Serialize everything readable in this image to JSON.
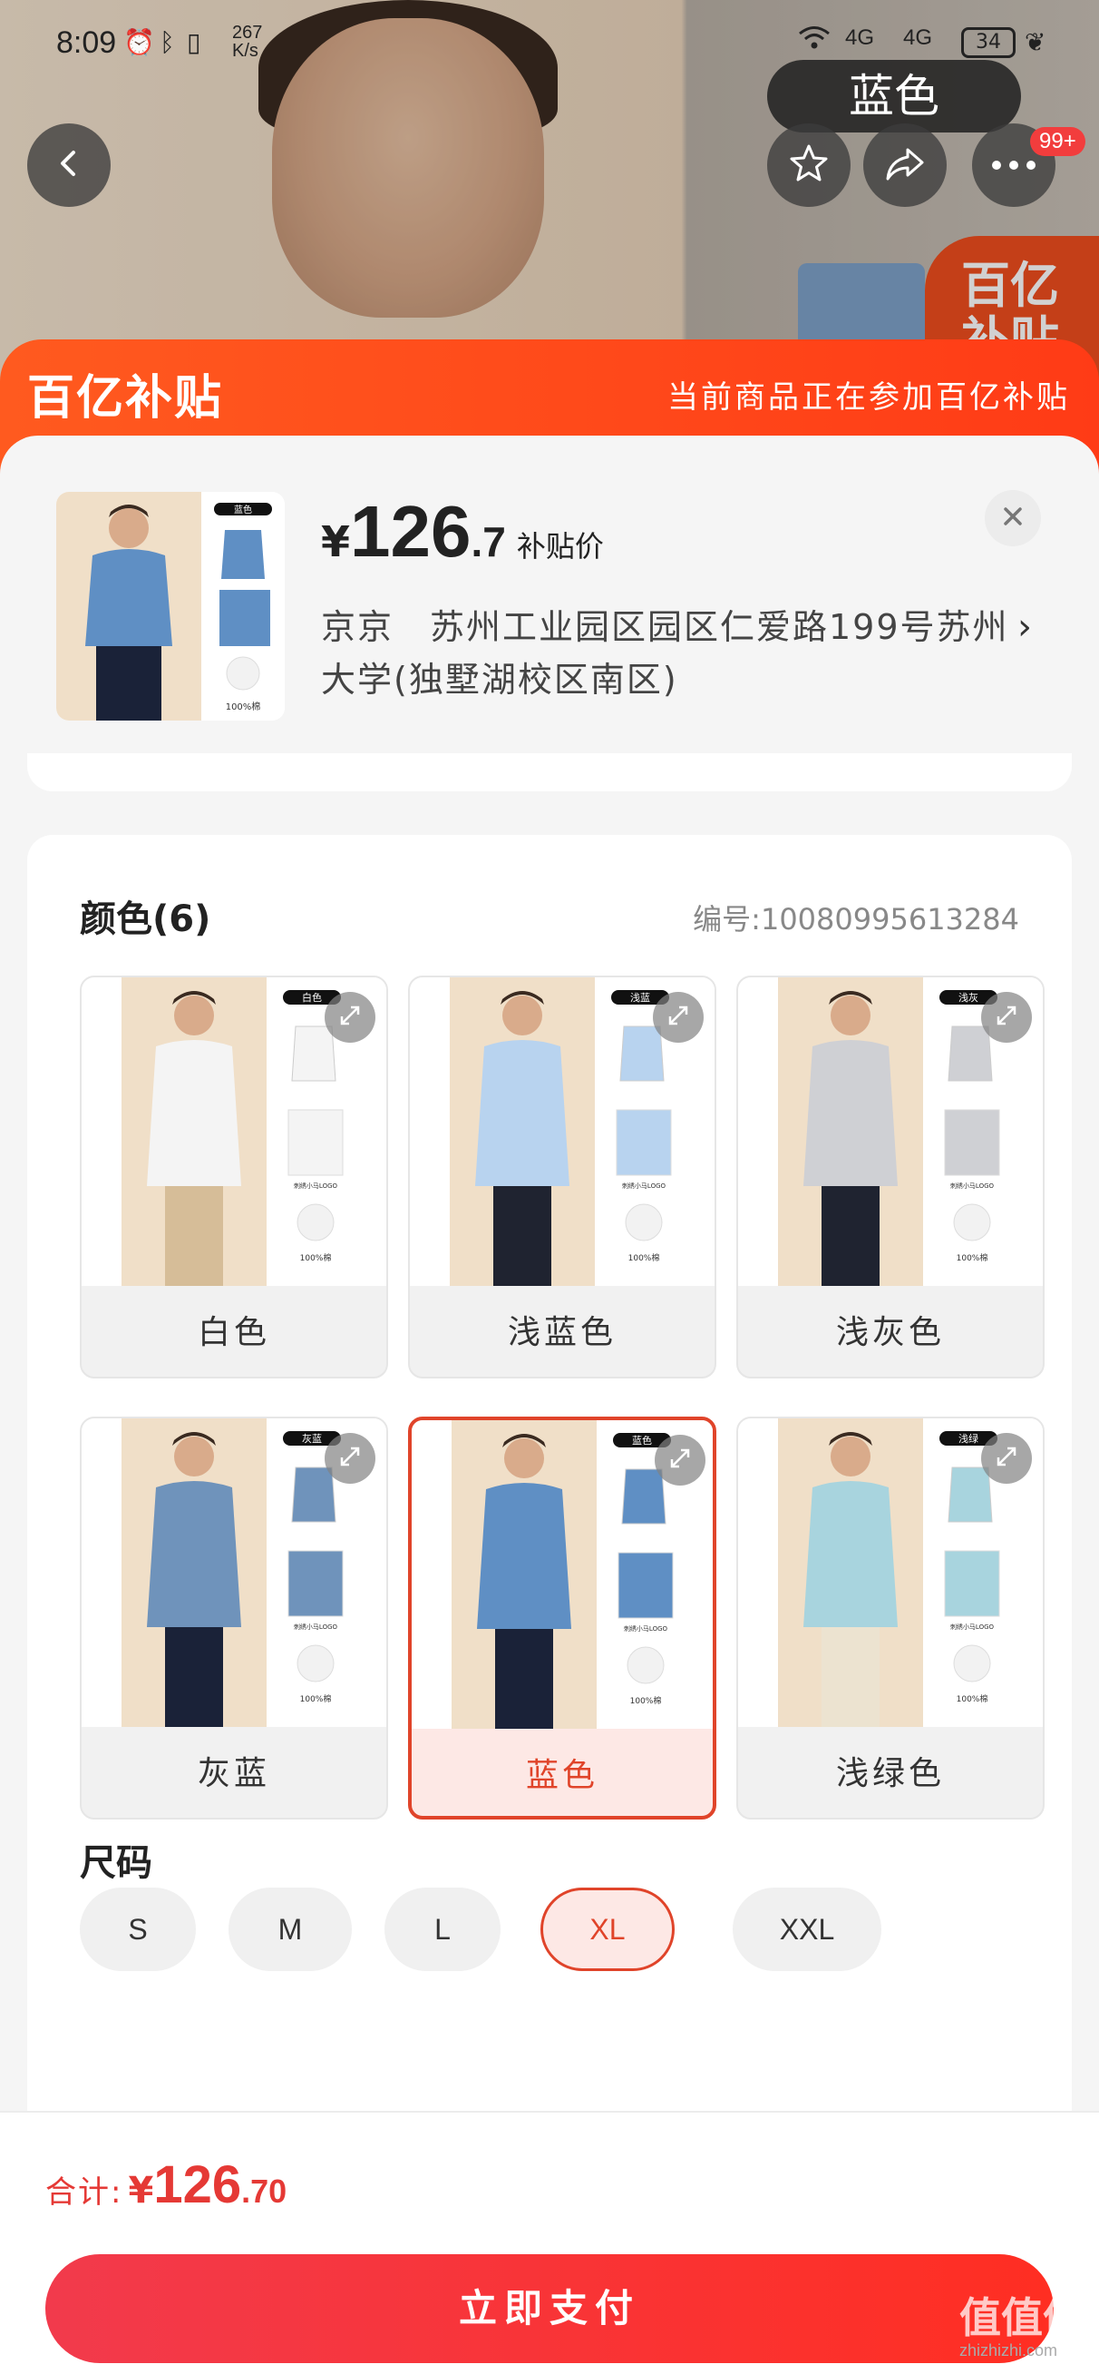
{
  "status_bar": {
    "time": "8:09",
    "net_speed_value": "267",
    "net_speed_unit": "K/s",
    "network_1": "4G",
    "network_2": "4G",
    "battery": "34"
  },
  "top_nav": {
    "selected_color_pill": "蓝色",
    "notification_count": "99+",
    "icons": [
      "back-icon",
      "star-icon",
      "share-icon",
      "more-icon"
    ]
  },
  "banner": {
    "logo_text": "百亿补贴",
    "message": "当前商品正在参加百亿补贴"
  },
  "product": {
    "price_symbol": "¥",
    "price_integer": "126",
    "price_decimal": ".7",
    "price_tag": "补贴价",
    "thumb_color_tag": "蓝色",
    "thumb_caption": "100%棉",
    "address": "京京　苏州工业园区园区仁爱路199号苏州大学(独墅湖校区南区)",
    "address_chevron": "›"
  },
  "colors": {
    "title": "颜色(6)",
    "code": "编号:10080995613284",
    "options": [
      {
        "label": "白色",
        "tag": "白色",
        "shirt": "#f4f4f4",
        "pants": "#d6bd98",
        "selected": false
      },
      {
        "label": "浅蓝色",
        "tag": "浅蓝",
        "shirt": "#b8d3ef",
        "pants": "#1f2330",
        "selected": false
      },
      {
        "label": "浅灰色",
        "tag": "浅灰",
        "shirt": "#cfd0d4",
        "pants": "#1f2330",
        "selected": false
      },
      {
        "label": "灰蓝",
        "tag": "灰蓝",
        "shirt": "#6f93bb",
        "pants": "#1a2238",
        "selected": false
      },
      {
        "label": "蓝色",
        "tag": "蓝色",
        "shirt": "#5f8fc4",
        "pants": "#1a2238",
        "selected": true
      },
      {
        "label": "浅绿色",
        "tag": "浅绿",
        "shirt": "#a8d4de",
        "pants": "#ece3d0",
        "selected": false
      }
    ],
    "caption_logo": "刺绣小马LOGO",
    "caption_cotton": "100%棉"
  },
  "sizes": {
    "title": "尺码",
    "options": [
      {
        "label": "S",
        "selected": false
      },
      {
        "label": "M",
        "selected": false
      },
      {
        "label": "L",
        "selected": false
      },
      {
        "label": "XL",
        "selected": true
      },
      {
        "label": "XXL",
        "selected": false
      }
    ]
  },
  "footer": {
    "total_label": "合计:",
    "total_symbol": "¥",
    "total_integer": "126",
    "total_decimal": ".70",
    "pay_button": "立即支付",
    "watermark": "值值值",
    "watermark_url": "zhizhizhi.com"
  },
  "theme": {
    "accent": "#e0442a",
    "banner": "#ff4a1a",
    "pay_button": "#f23a4c"
  }
}
